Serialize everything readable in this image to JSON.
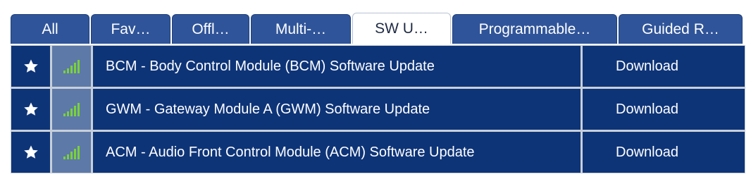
{
  "tabs": [
    {
      "label": "All",
      "active": false
    },
    {
      "label": "Fav…",
      "active": false
    },
    {
      "label": "Offl…",
      "active": false
    },
    {
      "label": "Multi-…",
      "active": false
    },
    {
      "label": "SW U…",
      "active": true
    },
    {
      "label": "Programmable…",
      "active": false
    },
    {
      "label": "Guided R…",
      "active": false
    }
  ],
  "rows": [
    {
      "name": "BCM - Body Control Module (BCM) Software Update",
      "action": "Download",
      "icons": {
        "favorite": "star-icon",
        "signal": "signal-bars-icon"
      }
    },
    {
      "name": "GWM - Gateway Module A (GWM) Software Update",
      "action": "Download",
      "icons": {
        "favorite": "star-icon",
        "signal": "signal-bars-icon"
      }
    },
    {
      "name": "ACM - Audio Front Control Module (ACM) Software Update",
      "action": "Download",
      "icons": {
        "favorite": "star-icon",
        "signal": "signal-bars-icon"
      }
    }
  ],
  "colors": {
    "tab": "#2f5499",
    "tab_active": "#ffffff",
    "row": "#0e3478",
    "signal_cell": "#5d79a8",
    "signal_bars": "#7ad13a"
  }
}
